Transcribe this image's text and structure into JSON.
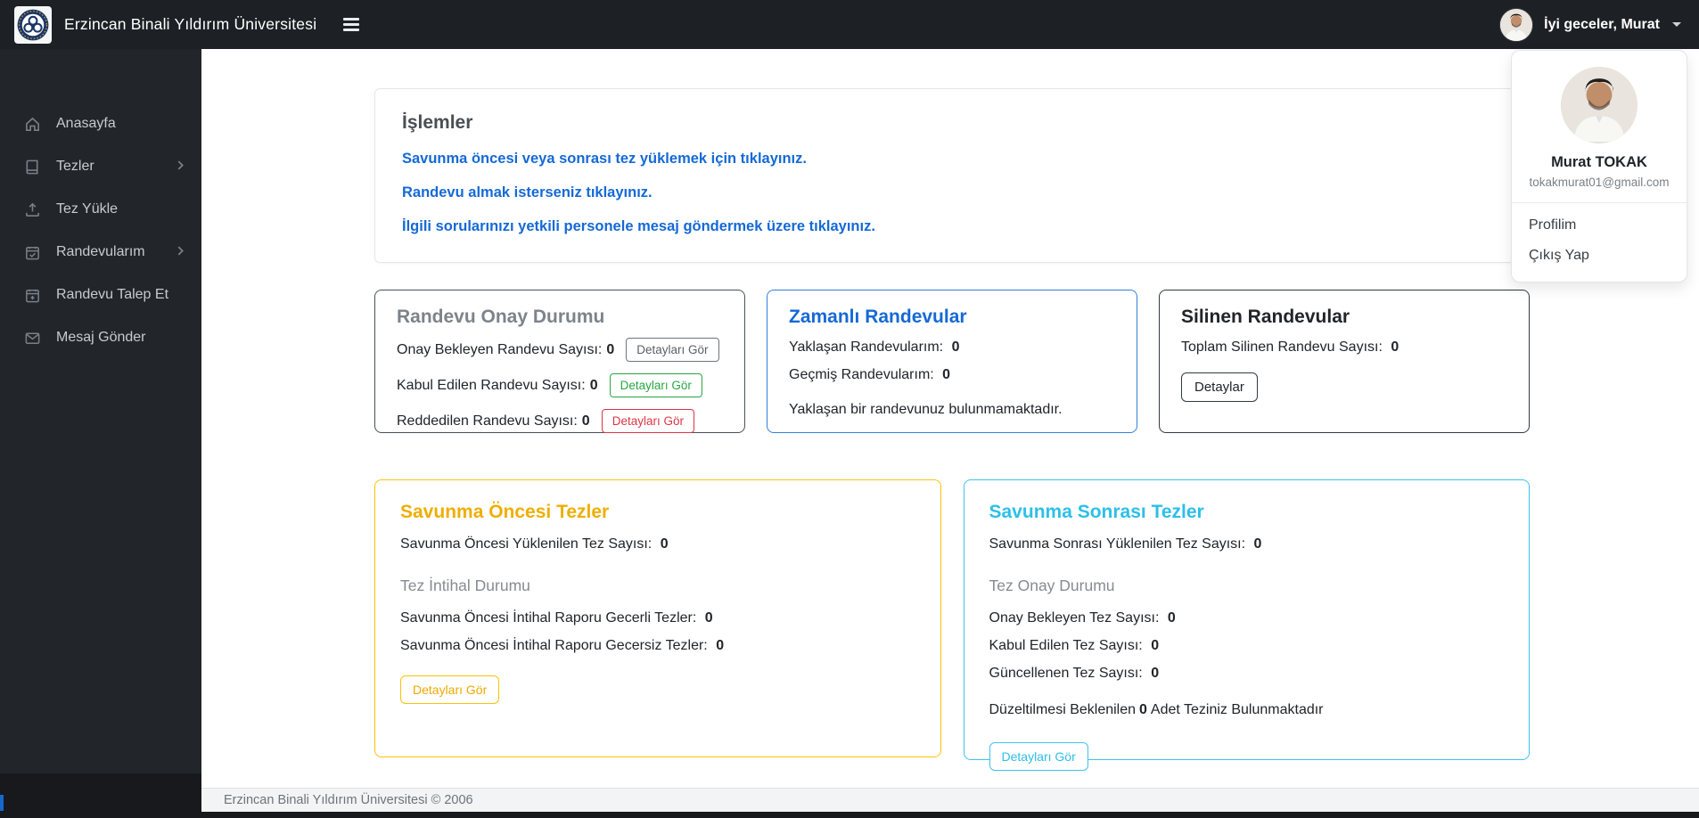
{
  "navbar": {
    "brand": "Erzincan Binali Yıldırım Üniversitesi",
    "greeting": "İyi geceler, Murat"
  },
  "user_menu": {
    "name": "Murat TOKAK",
    "email": "tokakmurat01@gmail.com",
    "profile_label": "Profilim",
    "logout_label": "Çıkış Yap"
  },
  "sidebar": {
    "items": [
      {
        "label": "Anasayfa",
        "icon": "home-icon",
        "has_submenu": false
      },
      {
        "label": "Tezler",
        "icon": "book-icon",
        "has_submenu": true
      },
      {
        "label": "Tez Yükle",
        "icon": "upload-icon",
        "has_submenu": false
      },
      {
        "label": "Randevularım",
        "icon": "calendar-check-icon",
        "has_submenu": true
      },
      {
        "label": "Randevu Talep Et",
        "icon": "calendar-plus-icon",
        "has_submenu": false
      },
      {
        "label": "Mesaj Gönder",
        "icon": "envelope-icon",
        "has_submenu": false
      }
    ]
  },
  "islemler": {
    "title": "İşlemler",
    "links": [
      "Savunma öncesi veya sonrası tez yüklemek için tıklayınız.",
      "Randevu almak isterseniz tıklayınız.",
      "İlgili sorularınızı yetkili personele mesaj göndermek üzere tıklayınız."
    ]
  },
  "randevu_onay": {
    "title": "Randevu Onay Durumu",
    "rows": [
      {
        "label": "Onay Bekleyen Randevu Sayısı:",
        "value": "0",
        "button": "Detayları Gör"
      },
      {
        "label": "Kabul Edilen Randevu Sayısı:",
        "value": "0",
        "button": "Detayları Gör"
      },
      {
        "label": "Reddedilen Randevu Sayısı:",
        "value": "0",
        "button": "Detayları Gör"
      }
    ]
  },
  "zamanli": {
    "title": "Zamanlı Randevular",
    "rows": [
      {
        "label": "Yaklaşan Randevularım:",
        "value": "0"
      },
      {
        "label": "Geçmiş Randevularım:",
        "value": "0"
      }
    ],
    "note": "Yaklaşan bir randevunuz bulunmamaktadır."
  },
  "silinen": {
    "title": "Silinen Randevular",
    "row": {
      "label": "Toplam Silinen Randevu Sayısı:",
      "value": "0"
    },
    "button": "Detaylar"
  },
  "savunma_oncesi": {
    "title": "Savunma Öncesi Tezler",
    "row": {
      "label": "Savunma Öncesi Yüklenilen Tez Sayısı:",
      "value": "0"
    },
    "subtitle": "Tez İntihal Durumu",
    "rows": [
      {
        "label": "Savunma Öncesi İntihal Raporu Gecerli Tezler:",
        "value": "0"
      },
      {
        "label": "Savunma Öncesi İntihal Raporu Gecersiz Tezler:",
        "value": "0"
      }
    ],
    "button": "Detayları Gör"
  },
  "savunma_sonrasi": {
    "title": "Savunma Sonrası Tezler",
    "row": {
      "label": "Savunma Sonrası Yüklenilen Tez Sayısı:",
      "value": "0"
    },
    "subtitle": "Tez Onay Durumu",
    "rows": [
      {
        "label": "Onay Bekleyen Tez Sayısı:",
        "value": "0"
      },
      {
        "label": "Kabul Edilen Tez Sayısı:",
        "value": "0"
      },
      {
        "label": "Güncellenen Tez Sayısı:",
        "value": "0"
      }
    ],
    "note": {
      "prefix": "Düzeltilmesi Beklenilen",
      "value": "0",
      "suffix": "Adet Teziniz Bulunmaktadır"
    },
    "button": "Detayları Gör"
  },
  "footer": {
    "text": "Erzincan Binali Yıldırım Üniversitesi © 2006"
  },
  "colors": {
    "navbar_bg": "#1d2125",
    "sidebar_bg": "#22262a",
    "link_blue": "#1569d6",
    "card_blue_border": "#2f80d9",
    "warning_yellow": "#ffc107",
    "info_cyan": "#3cc4ec",
    "success_green": "#28a745",
    "danger_red": "#dc3545",
    "dark_border": "#343a40",
    "muted_gray": "#6c757d"
  }
}
